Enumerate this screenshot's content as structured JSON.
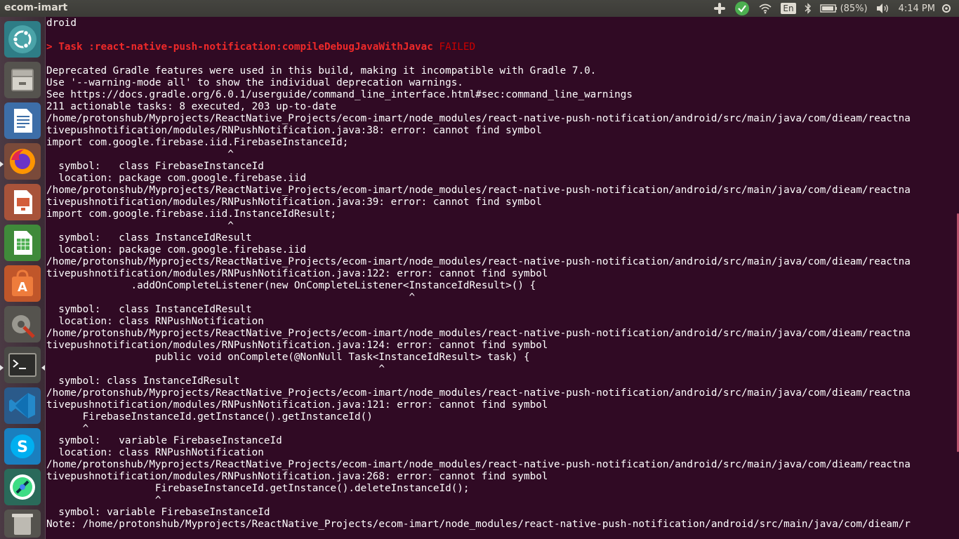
{
  "topbar": {
    "app_title": "ecom-imart",
    "battery_text": "(85%)",
    "clock": "4:14 PM",
    "lang": "En"
  },
  "launcher": {
    "items": [
      "ubuntu-dash",
      "files",
      "libreoffice-writer",
      "firefox",
      "libreoffice-impress",
      "libreoffice-calc",
      "ubuntu-software",
      "system-settings",
      "terminal",
      "vscode",
      "skype",
      "android-studio",
      "trash"
    ]
  },
  "terminal": {
    "task_prefix": "> Task :react-native-push-notification:compileDebugJavaWithJavac ",
    "task_status": "FAILED",
    "lines": [
      "droid",
      "",
      "",
      "",
      "Deprecated Gradle features were used in this build, making it incompatible with Gradle 7.0.",
      "Use '--warning-mode all' to show the individual deprecation warnings.",
      "See https://docs.gradle.org/6.0.1/userguide/command_line_interface.html#sec:command_line_warnings",
      "211 actionable tasks: 8 executed, 203 up-to-date",
      "/home/protonshub/Myprojects/ReactNative_Projects/ecom-imart/node_modules/react-native-push-notification/android/src/main/java/com/dieam/reactna",
      "tivepushnotification/modules/RNPushNotification.java:38: error: cannot find symbol",
      "import com.google.firebase.iid.FirebaseInstanceId;",
      "                              ^",
      "  symbol:   class FirebaseInstanceId",
      "  location: package com.google.firebase.iid",
      "/home/protonshub/Myprojects/ReactNative_Projects/ecom-imart/node_modules/react-native-push-notification/android/src/main/java/com/dieam/reactna",
      "tivepushnotification/modules/RNPushNotification.java:39: error: cannot find symbol",
      "import com.google.firebase.iid.InstanceIdResult;",
      "                              ^",
      "  symbol:   class InstanceIdResult",
      "  location: package com.google.firebase.iid",
      "/home/protonshub/Myprojects/ReactNative_Projects/ecom-imart/node_modules/react-native-push-notification/android/src/main/java/com/dieam/reactna",
      "tivepushnotification/modules/RNPushNotification.java:122: error: cannot find symbol",
      "              .addOnCompleteListener(new OnCompleteListener<InstanceIdResult>() {",
      "                                                            ^",
      "  symbol:   class InstanceIdResult",
      "  location: class RNPushNotification",
      "/home/protonshub/Myprojects/ReactNative_Projects/ecom-imart/node_modules/react-native-push-notification/android/src/main/java/com/dieam/reactna",
      "tivepushnotification/modules/RNPushNotification.java:124: error: cannot find symbol",
      "                  public void onComplete(@NonNull Task<InstanceIdResult> task) {",
      "                                                       ^",
      "  symbol: class InstanceIdResult",
      "/home/protonshub/Myprojects/ReactNative_Projects/ecom-imart/node_modules/react-native-push-notification/android/src/main/java/com/dieam/reactna",
      "tivepushnotification/modules/RNPushNotification.java:121: error: cannot find symbol",
      "      FirebaseInstanceId.getInstance().getInstanceId()",
      "      ^",
      "  symbol:   variable FirebaseInstanceId",
      "  location: class RNPushNotification",
      "/home/protonshub/Myprojects/ReactNative_Projects/ecom-imart/node_modules/react-native-push-notification/android/src/main/java/com/dieam/reactna",
      "tivepushnotification/modules/RNPushNotification.java:268: error: cannot find symbol",
      "                  FirebaseInstanceId.getInstance().deleteInstanceId();",
      "                  ^",
      "  symbol: variable FirebaseInstanceId",
      "Note: /home/protonshub/Myprojects/ReactNative_Projects/ecom-imart/node_modules/react-native-push-notification/android/src/main/java/com/dieam/r"
    ]
  }
}
